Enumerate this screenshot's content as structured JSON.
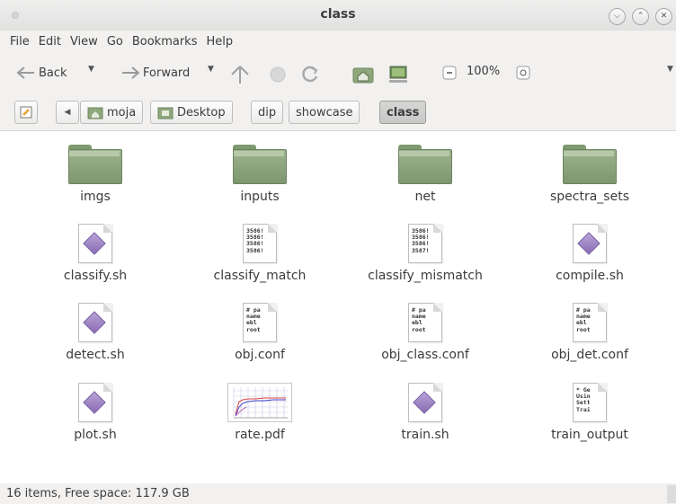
{
  "window": {
    "title": "class",
    "controls": [
      "minimize",
      "maximize",
      "close"
    ]
  },
  "menubar": {
    "items": [
      "File",
      "Edit",
      "View",
      "Go",
      "Bookmarks",
      "Help"
    ]
  },
  "toolbar": {
    "back_label": "Back",
    "forward_label": "Forward",
    "zoom_value": "100%",
    "icons": [
      "back-icon",
      "forward-icon",
      "up-icon",
      "stop-icon",
      "reload-icon",
      "home-icon",
      "computer-icon",
      "zoom-out-icon",
      "zoom-in-icon"
    ]
  },
  "location": {
    "crumbs": [
      "moja",
      "Desktop",
      "dip",
      "showcase",
      "class"
    ],
    "active": "class"
  },
  "files": [
    {
      "name": "imgs",
      "type": "folder"
    },
    {
      "name": "inputs",
      "type": "folder"
    },
    {
      "name": "net",
      "type": "folder"
    },
    {
      "name": "spectra_sets",
      "type": "folder"
    },
    {
      "name": "classify.sh",
      "type": "script"
    },
    {
      "name": "classify_match",
      "type": "text",
      "preview": "3586!\n3586!\n3586!\n3586!"
    },
    {
      "name": "classify_mismatch",
      "type": "text",
      "preview": "3586!\n3586!\n3586!\n3587!"
    },
    {
      "name": "compile.sh",
      "type": "script"
    },
    {
      "name": "detect.sh",
      "type": "script"
    },
    {
      "name": "obj.conf",
      "type": "text",
      "preview": "# pa\nname\nebl\nroot"
    },
    {
      "name": "obj_class.conf",
      "type": "text",
      "preview": "# pa\nname\nebl\nroot"
    },
    {
      "name": "obj_det.conf",
      "type": "text",
      "preview": "# pa\nname\nebl\nroot"
    },
    {
      "name": "plot.sh",
      "type": "script"
    },
    {
      "name": "rate.pdf",
      "type": "pdf"
    },
    {
      "name": "train.sh",
      "type": "script"
    },
    {
      "name": "train_output",
      "type": "text",
      "preview": "* Ge\nUsin\nSett\nTrai"
    }
  ],
  "status": {
    "text": "16 items, Free space: 117.9 GB"
  }
}
